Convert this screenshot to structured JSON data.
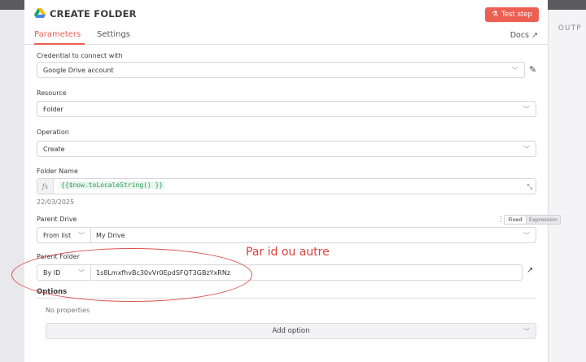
{
  "node": {
    "title": "CREATE FOLDER",
    "test_step_label": "Test step",
    "icon": "google-drive-icon"
  },
  "tabs": {
    "parameters": "Parameters",
    "settings": "Settings",
    "docs": "Docs"
  },
  "output_label": "OUTP",
  "fields": {
    "credential": {
      "label": "Credential to connect with",
      "value": "Google Drive account"
    },
    "resource": {
      "label": "Resource",
      "value": "Folder"
    },
    "operation": {
      "label": "Operation",
      "value": "Create"
    },
    "folder_name": {
      "label": "Folder Name",
      "fx": "fx",
      "expression": "{{$now.toLocaleString() }}",
      "preview": "22/03/2025"
    },
    "parent_drive": {
      "label": "Parent Drive",
      "mode": "From list",
      "value": "My Drive",
      "toggle_fixed": "Fixed",
      "toggle_expression": "Expression"
    },
    "parent_folder": {
      "label": "Parent Folder",
      "mode": "By ID",
      "value": "1s8LmxfhvBc30vVr0EpdSFQT3GBzYxRNz"
    }
  },
  "options": {
    "label": "Options",
    "empty_text": "No properties",
    "add_label": "Add option"
  },
  "annotation": {
    "text": "Par id ou autre",
    "color": "#e0403a"
  },
  "colors": {
    "accent": "#ec5f52",
    "expression_green": "#2e9a5c"
  }
}
